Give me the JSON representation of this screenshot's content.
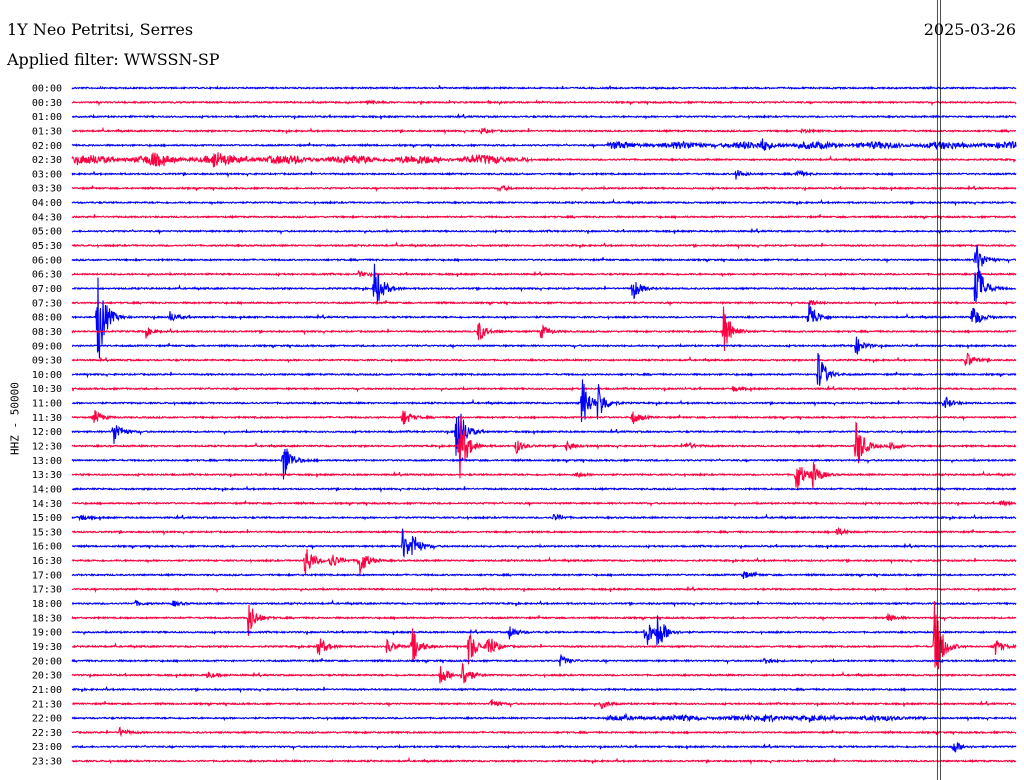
{
  "header": {
    "station": "1Y Neo Petritsi, Serres",
    "filter": "Applied filter: WWSSN-SP",
    "date": "2025-03-26"
  },
  "chart_data": {
    "type": "line",
    "title": "1Y Neo Petritsi, Serres",
    "ylabel": "HHZ - 50000",
    "x_unit": "minutes within 30-minute trace",
    "xlim": [
      0,
      30
    ],
    "colors": {
      "even": "#0000ff",
      "odd": "#ff0040",
      "marker": "#000000"
    },
    "marker_minute": 27.5,
    "traces": [
      {
        "label": "00:00",
        "events": []
      },
      {
        "label": "00:30",
        "events": [
          {
            "t": 9.4,
            "amp": 3
          }
        ]
      },
      {
        "label": "01:00",
        "events": []
      },
      {
        "label": "01:30",
        "events": [
          {
            "t": 13.0,
            "amp": 3
          },
          {
            "t": 23.2,
            "amp": 2
          }
        ]
      },
      {
        "label": "02:00",
        "noise": [
          [
            17.0,
            30,
            3
          ]
        ],
        "events": [
          {
            "t": 21.9,
            "amp": 6
          }
        ]
      },
      {
        "label": "02:30",
        "noise": [
          [
            0,
            14.5,
            4
          ]
        ],
        "events": [
          {
            "t": 4.5,
            "amp": 7
          },
          {
            "t": 2.5,
            "amp": 5
          }
        ]
      },
      {
        "label": "03:00",
        "events": [
          {
            "t": 21.1,
            "amp": 5
          },
          {
            "t": 23.0,
            "amp": 4
          }
        ]
      },
      {
        "label": "03:30",
        "events": [
          {
            "t": 13.6,
            "amp": 3
          }
        ]
      },
      {
        "label": "04:00",
        "events": []
      },
      {
        "label": "04:30",
        "events": []
      },
      {
        "label": "05:00",
        "events": []
      },
      {
        "label": "05:30",
        "events": []
      },
      {
        "label": "06:00",
        "events": [
          {
            "t": 28.7,
            "amp": 20
          }
        ]
      },
      {
        "label": "06:30",
        "events": [
          {
            "t": 9.1,
            "amp": 3
          }
        ]
      },
      {
        "label": "07:00",
        "events": [
          {
            "t": 9.6,
            "amp": 30
          },
          {
            "t": 17.8,
            "amp": 14
          },
          {
            "t": 28.7,
            "amp": 40
          }
        ]
      },
      {
        "label": "07:30",
        "events": [
          {
            "t": 23.4,
            "amp": 4
          }
        ]
      },
      {
        "label": "08:00",
        "events": [
          {
            "t": 0.8,
            "amp": 60
          },
          {
            "t": 3.1,
            "amp": 6
          },
          {
            "t": 23.4,
            "amp": 20
          },
          {
            "t": 28.6,
            "amp": 15
          }
        ]
      },
      {
        "label": "08:30",
        "events": [
          {
            "t": 2.3,
            "amp": 6
          },
          {
            "t": 12.9,
            "amp": 12
          },
          {
            "t": 14.9,
            "amp": 8
          },
          {
            "t": 20.7,
            "amp": 30
          }
        ]
      },
      {
        "label": "09:00",
        "events": [
          {
            "t": 24.9,
            "amp": 10
          }
        ]
      },
      {
        "label": "09:30",
        "events": [
          {
            "t": 28.4,
            "amp": 10
          }
        ]
      },
      {
        "label": "10:00",
        "events": [
          {
            "t": 23.7,
            "amp": 25
          }
        ]
      },
      {
        "label": "10:30",
        "events": [
          {
            "t": 21.0,
            "amp": 3
          }
        ]
      },
      {
        "label": "11:00",
        "events": [
          {
            "t": 16.2,
            "amp": 30
          },
          {
            "t": 16.7,
            "amp": 20
          },
          {
            "t": 27.7,
            "amp": 8
          }
        ]
      },
      {
        "label": "11:30",
        "events": [
          {
            "t": 0.7,
            "amp": 8
          },
          {
            "t": 10.5,
            "amp": 10
          },
          {
            "t": 17.8,
            "amp": 8
          }
        ]
      },
      {
        "label": "12:00",
        "events": [
          {
            "t": 1.3,
            "amp": 15
          },
          {
            "t": 12.2,
            "amp": 40
          }
        ]
      },
      {
        "label": "12:30",
        "events": [
          {
            "t": 12.3,
            "amp": 40
          },
          {
            "t": 14.1,
            "amp": 8
          },
          {
            "t": 15.7,
            "amp": 5
          },
          {
            "t": 19.5,
            "amp": 5
          },
          {
            "t": 24.9,
            "amp": 30
          },
          {
            "t": 26.0,
            "amp": 6
          }
        ]
      },
      {
        "label": "13:00",
        "events": [
          {
            "t": 6.7,
            "amp": 25
          }
        ]
      },
      {
        "label": "13:30",
        "events": [
          {
            "t": 23.0,
            "amp": 20
          },
          {
            "t": 23.5,
            "amp": 15
          },
          {
            "t": 16.0,
            "amp": 3
          }
        ]
      },
      {
        "label": "14:00",
        "events": []
      },
      {
        "label": "14:30",
        "events": [
          {
            "t": 29.5,
            "amp": 3
          }
        ]
      },
      {
        "label": "15:00",
        "events": [
          {
            "t": 0.2,
            "amp": 4
          },
          {
            "t": 15.3,
            "amp": 4
          }
        ]
      },
      {
        "label": "15:30",
        "events": [
          {
            "t": 24.3,
            "amp": 5
          }
        ]
      },
      {
        "label": "16:00",
        "events": [
          {
            "t": 10.5,
            "amp": 18
          },
          {
            "t": 10.8,
            "amp": 12
          }
        ]
      },
      {
        "label": "16:30",
        "events": [
          {
            "t": 7.4,
            "amp": 20
          },
          {
            "t": 8.2,
            "amp": 10
          },
          {
            "t": 9.1,
            "amp": 20
          }
        ]
      },
      {
        "label": "17:00",
        "events": [
          {
            "t": 21.3,
            "amp": 5
          }
        ]
      },
      {
        "label": "17:30",
        "events": []
      },
      {
        "label": "18:00",
        "events": [
          {
            "t": 2.0,
            "amp": 3
          },
          {
            "t": 3.2,
            "amp": 3
          }
        ]
      },
      {
        "label": "18:30",
        "events": [
          {
            "t": 5.6,
            "amp": 20
          },
          {
            "t": 25.9,
            "amp": 5
          }
        ]
      },
      {
        "label": "19:00",
        "events": [
          {
            "t": 13.9,
            "amp": 8
          },
          {
            "t": 18.2,
            "amp": 20
          },
          {
            "t": 18.6,
            "amp": 20
          }
        ]
      },
      {
        "label": "19:30",
        "events": [
          {
            "t": 7.8,
            "amp": 12
          },
          {
            "t": 10.0,
            "amp": 8
          },
          {
            "t": 10.8,
            "amp": 20
          },
          {
            "t": 12.6,
            "amp": 20
          },
          {
            "t": 13.2,
            "amp": 15
          },
          {
            "t": 27.4,
            "amp": 50
          },
          {
            "t": 29.3,
            "amp": 10
          }
        ]
      },
      {
        "label": "20:00",
        "events": [
          {
            "t": 15.5,
            "amp": 6
          },
          {
            "t": 22.0,
            "amp": 4
          }
        ]
      },
      {
        "label": "20:30",
        "events": [
          {
            "t": 4.3,
            "amp": 4
          },
          {
            "t": 11.7,
            "amp": 12
          },
          {
            "t": 12.4,
            "amp": 15
          }
        ]
      },
      {
        "label": "21:00",
        "events": []
      },
      {
        "label": "21:30",
        "events": [
          {
            "t": 13.3,
            "amp": 5
          },
          {
            "t": 16.8,
            "amp": 5
          }
        ]
      },
      {
        "label": "22:00",
        "noise": [
          [
            17.0,
            27,
            2
          ]
        ],
        "events": [
          {
            "t": 22.0,
            "amp": 6
          }
        ]
      },
      {
        "label": "22:30",
        "events": [
          {
            "t": 1.5,
            "amp": 5
          }
        ]
      },
      {
        "label": "23:00",
        "events": [
          {
            "t": 28.0,
            "amp": 8
          }
        ]
      },
      {
        "label": "23:30",
        "events": []
      }
    ]
  }
}
